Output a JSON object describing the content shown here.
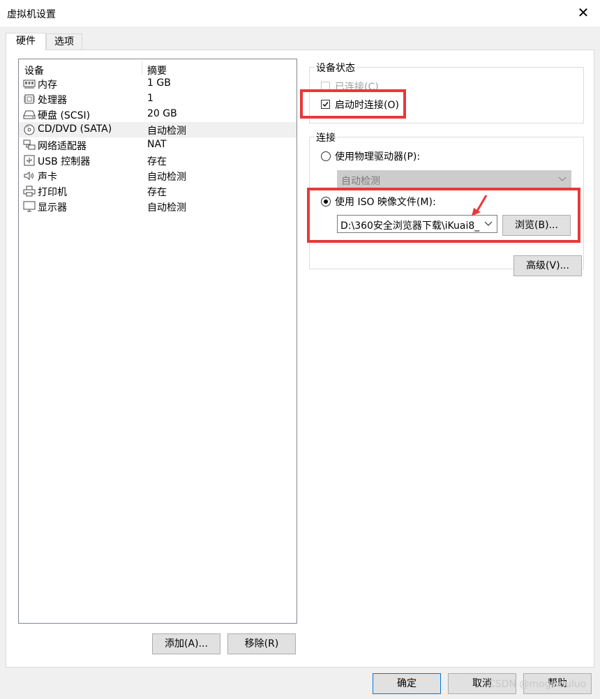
{
  "window": {
    "title": "虚拟机设置",
    "close_glyph": "✕"
  },
  "tabs": [
    {
      "label": "硬件"
    },
    {
      "label": "选项"
    }
  ],
  "device_list": {
    "columns": {
      "device": "设备",
      "summary": "摘要"
    },
    "items": [
      {
        "name": "内存",
        "summary": "1 GB",
        "icon": "memory-icon"
      },
      {
        "name": "处理器",
        "summary": "1",
        "icon": "cpu-icon"
      },
      {
        "name": "硬盘 (SCSI)",
        "summary": "20 GB",
        "icon": "harddisk-icon"
      },
      {
        "name": "CD/DVD (SATA)",
        "summary": "自动检测",
        "icon": "cd-dvd-icon",
        "selected": true
      },
      {
        "name": "网络适配器",
        "summary": "NAT",
        "icon": "network-adapter-icon"
      },
      {
        "name": "USB 控制器",
        "summary": "存在",
        "icon": "usb-icon"
      },
      {
        "name": "声卡",
        "summary": "自动检测",
        "icon": "speaker-icon"
      },
      {
        "name": "打印机",
        "summary": "存在",
        "icon": "printer-icon"
      },
      {
        "name": "显示器",
        "summary": "自动检测",
        "icon": "monitor-icon"
      }
    ]
  },
  "buttons": {
    "add": "添加(A)...",
    "remove": "移除(R)",
    "ok": "确定",
    "cancel": "取消",
    "help": "帮助",
    "browse": "浏览(B)...",
    "advanced": "高级(V)..."
  },
  "device_status": {
    "title": "设备状态",
    "connected": {
      "label": "已连接(C)",
      "checked": false,
      "enabled": false
    },
    "connect_at_power_on": {
      "label": "启动时连接(O)",
      "checked": true
    }
  },
  "connection": {
    "title": "连接",
    "physical_drive": {
      "label": "使用物理驱动器(P):",
      "selected": false,
      "value": "自动检测"
    },
    "iso_image": {
      "label": "使用 ISO 映像文件(M):",
      "selected": true,
      "path": "D:\\360安全浏览器下载\\iKuai8_"
    }
  },
  "annotation": {
    "color": "#e8383a"
  },
  "watermark": "CSDN @mogexiuluo"
}
